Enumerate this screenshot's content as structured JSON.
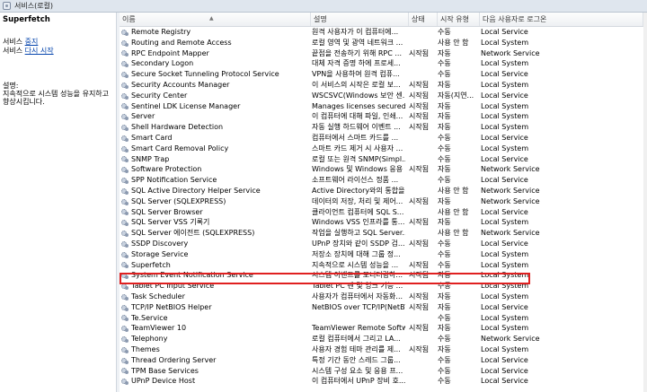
{
  "window": {
    "title": "서비스(로컬)"
  },
  "left": {
    "service_name": "Superfetch",
    "stop_prefix": "서비스 ",
    "stop_link": "중지",
    "restart_prefix": "서비스 ",
    "restart_link": "다시 시작",
    "desc_label": "설명:",
    "desc_text": "지속적으로 시스템 성능을 유지하고 향상시킵니다."
  },
  "columns": {
    "name": "이름",
    "desc": "설명",
    "status": "상태",
    "start": "시작 유형",
    "logon": "다음 사용자로 로그온"
  },
  "rows": [
    {
      "name": "Remote Registry",
      "desc": "원격 사용자가 이 컴퓨터에...",
      "status": "",
      "start": "수동",
      "logon": "Local Service"
    },
    {
      "name": "Routing and Remote Access",
      "desc": "로컬 영역 및 광역 네트워크 ...",
      "status": "",
      "start": "사용 안 함",
      "logon": "Local System"
    },
    {
      "name": "RPC Endpoint Mapper",
      "desc": "끝점을 전송하기 위해 RPC ...",
      "status": "시작됨",
      "start": "자동",
      "logon": "Network Service"
    },
    {
      "name": "Secondary Logon",
      "desc": "대체 자격 증명 하에 프로세...",
      "status": "",
      "start": "수동",
      "logon": "Local System"
    },
    {
      "name": "Secure Socket Tunneling Protocol Service",
      "desc": "VPN을 사용하여 원격 컴퓨...",
      "status": "",
      "start": "수동",
      "logon": "Local Service"
    },
    {
      "name": "Security Accounts Manager",
      "desc": "이 서비스의 시작은 로컬 보...",
      "status": "시작됨",
      "start": "자동",
      "logon": "Local System"
    },
    {
      "name": "Security Center",
      "desc": "WSCSVC(Windows 보안 센...",
      "status": "시작됨",
      "start": "자동(지연...",
      "logon": "Local Service"
    },
    {
      "name": "Sentinel LDK License Manager",
      "desc": "Manages licenses secured b...",
      "status": "시작됨",
      "start": "자동",
      "logon": "Local System"
    },
    {
      "name": "Server",
      "desc": "이 컴퓨터에 대해 파일, 인쇄...",
      "status": "시작됨",
      "start": "자동",
      "logon": "Local System"
    },
    {
      "name": "Shell Hardware Detection",
      "desc": "자동 실행 하드웨어 이벤트 ...",
      "status": "시작됨",
      "start": "자동",
      "logon": "Local System"
    },
    {
      "name": "Smart Card",
      "desc": "컴퓨터에서 스마트 카드를 ...",
      "status": "",
      "start": "수동",
      "logon": "Local Service"
    },
    {
      "name": "Smart Card Removal Policy",
      "desc": "스마트 카드 제거 시 사용자 ...",
      "status": "",
      "start": "수동",
      "logon": "Local System"
    },
    {
      "name": "SNMP Trap",
      "desc": "로컬 또는 원격 SNMP(Simpl...",
      "status": "",
      "start": "수동",
      "logon": "Local Service"
    },
    {
      "name": "Software Protection",
      "desc": "Windows 및 Windows 응용 ...",
      "status": "시작됨",
      "start": "자동",
      "logon": "Network Service"
    },
    {
      "name": "SPP Notification Service",
      "desc": "소프트웨어 라이선스 정품 ...",
      "status": "",
      "start": "수동",
      "logon": "Local Service"
    },
    {
      "name": "SQL Active Directory Helper Service",
      "desc": "Active Directory와의 통합을...",
      "status": "",
      "start": "사용 안 함",
      "logon": "Network Service"
    },
    {
      "name": "SQL Server (SQLEXPRESS)",
      "desc": "데이터의 저장, 처리 및 제어...",
      "status": "시작됨",
      "start": "자동",
      "logon": "Network Service"
    },
    {
      "name": "SQL Server Browser",
      "desc": "클라이언트 컴퓨터에 SQL S...",
      "status": "",
      "start": "사용 안 함",
      "logon": "Local Service"
    },
    {
      "name": "SQL Server VSS 기록기",
      "desc": "Windows VSS 인프라를 통...",
      "status": "시작됨",
      "start": "자동",
      "logon": "Local System"
    },
    {
      "name": "SQL Server 에이전트 (SQLEXPRESS)",
      "desc": "작업을 실행하고 SQL Server...",
      "status": "",
      "start": "사용 안 함",
      "logon": "Network Service"
    },
    {
      "name": "SSDP Discovery",
      "desc": "UPnP 장치와 같이 SSDP 검...",
      "status": "시작됨",
      "start": "수동",
      "logon": "Local Service"
    },
    {
      "name": "Storage Service",
      "desc": "저장소 장치에 대해 그룹 정...",
      "status": "",
      "start": "수동",
      "logon": "Local System"
    },
    {
      "name": "Superfetch",
      "desc": "지속적으로 시스템 성능을 ...",
      "status": "시작됨",
      "start": "수동",
      "logon": "Local System"
    },
    {
      "name": "System Event Notification Service",
      "desc": "시스템 이벤트를 모니터링하...",
      "status": "시작됨",
      "start": "자동",
      "logon": "Local System"
    },
    {
      "name": "Tablet PC Input Service",
      "desc": "Tablet PC 펜 및 잉크 기능 ...",
      "status": "",
      "start": "수동",
      "logon": "Local System"
    },
    {
      "name": "Task Scheduler",
      "desc": "사용자가 컴퓨터에서 자동화...",
      "status": "시작됨",
      "start": "자동",
      "logon": "Local System"
    },
    {
      "name": "TCP/IP NetBIOS Helper",
      "desc": "NetBIOS over TCP/IP(NetBT)...",
      "status": "시작됨",
      "start": "자동",
      "logon": "Local Service"
    },
    {
      "name": "Te.Service",
      "desc": "",
      "status": "",
      "start": "수동",
      "logon": "Local System"
    },
    {
      "name": "TeamViewer 10",
      "desc": "TeamViewer Remote Software",
      "status": "시작됨",
      "start": "자동",
      "logon": "Local System"
    },
    {
      "name": "Telephony",
      "desc": "로컬 컴퓨터에서 그리고 LA...",
      "status": "",
      "start": "수동",
      "logon": "Network Service"
    },
    {
      "name": "Themes",
      "desc": "사용자 경험 테마 관리를 제...",
      "status": "시작됨",
      "start": "자동",
      "logon": "Local System"
    },
    {
      "name": "Thread Ordering Server",
      "desc": "특정 기간 동안 스레드 그룹...",
      "status": "",
      "start": "수동",
      "logon": "Local Service"
    },
    {
      "name": "TPM Base Services",
      "desc": "시스템 구성 요소 및 응용 프...",
      "status": "",
      "start": "수동",
      "logon": "Local Service"
    },
    {
      "name": "UPnP Device Host",
      "desc": "이 컴퓨터에서 UPnP 장비 호...",
      "status": "",
      "start": "수동",
      "logon": "Local Service"
    }
  ]
}
